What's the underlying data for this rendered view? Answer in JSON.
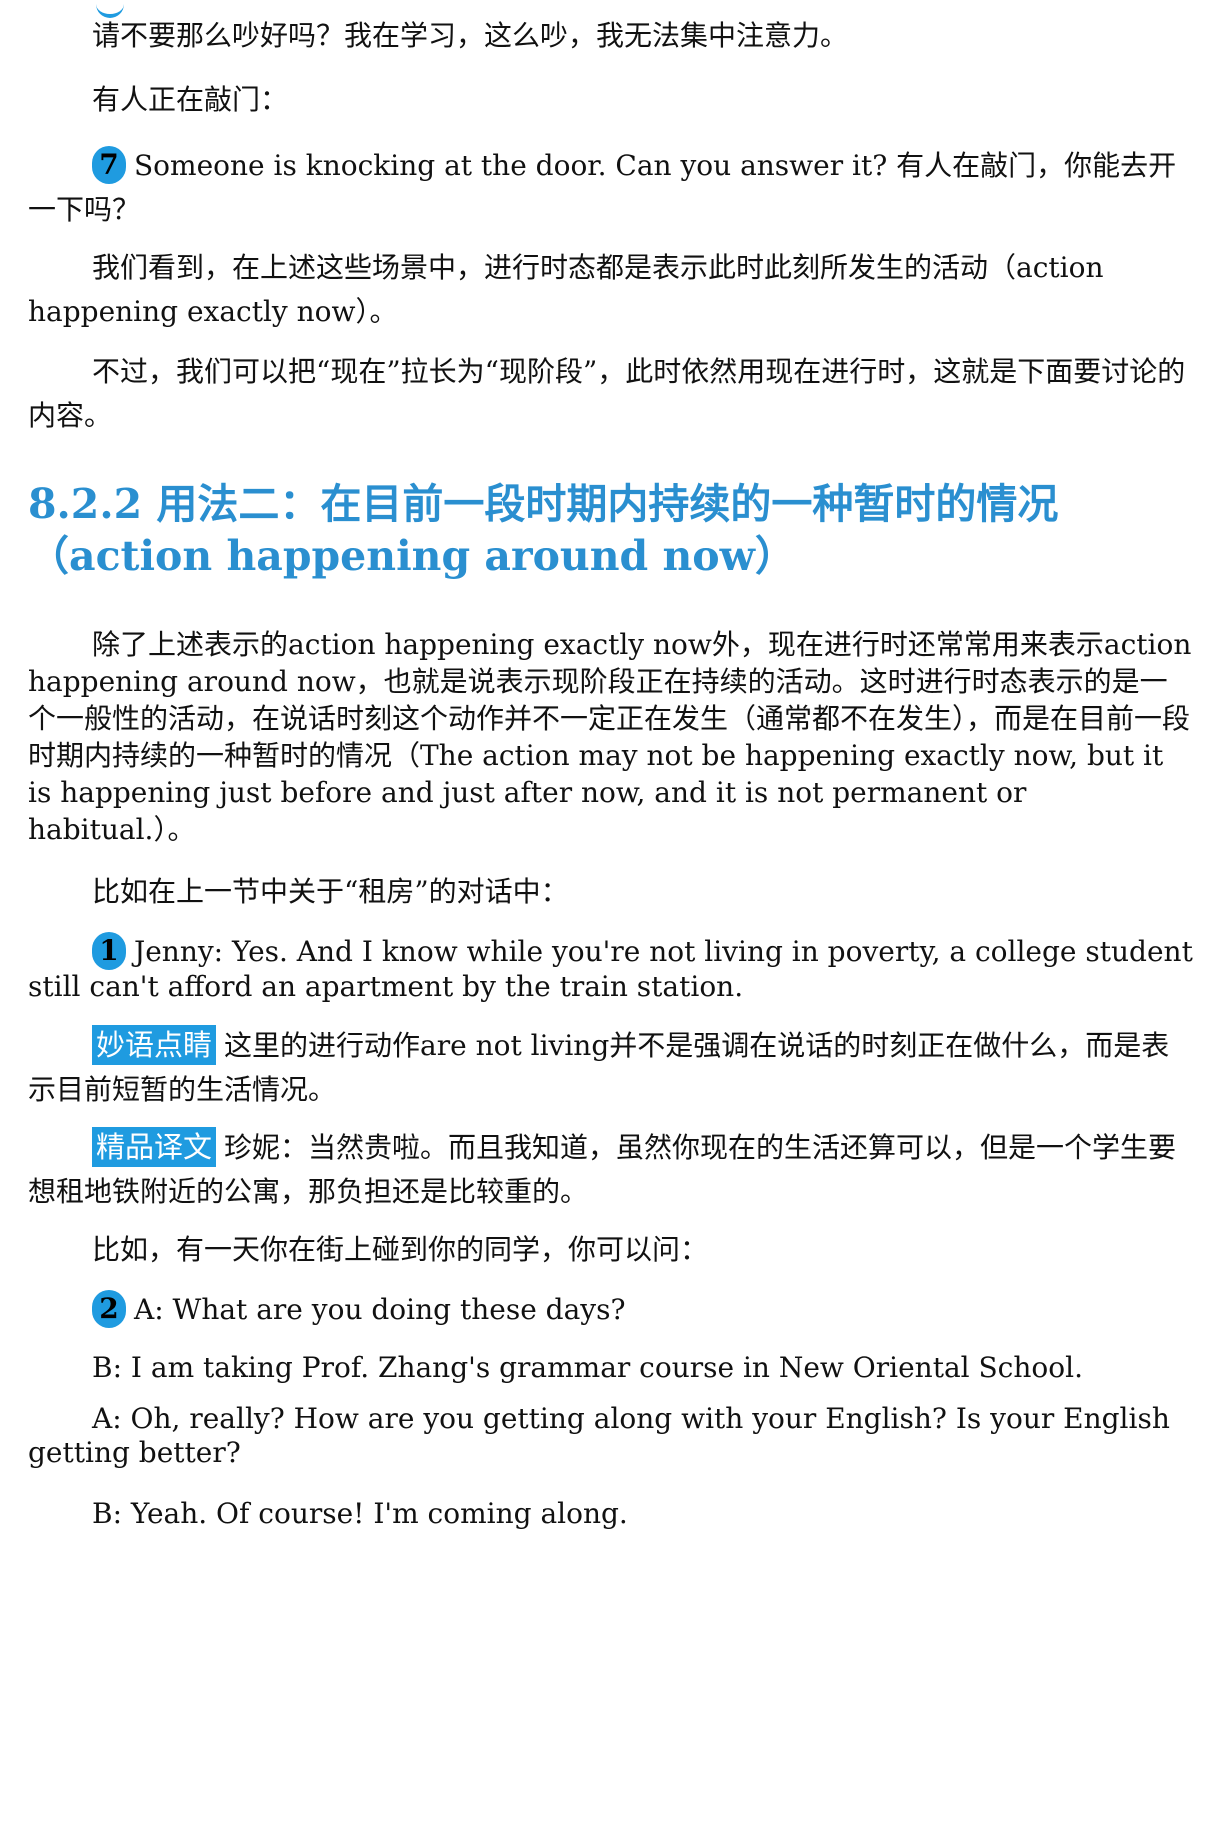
{
  "paragraphs": {
    "p_request_quiet": "请不要那么吵好吗？我在学习，这么吵，我无法集中注意力。",
    "p_knocking_intro": "有人正在敲门：",
    "p_example7_num": "7",
    "p_example7_text": "Someone is knocking at the door. Can you answer it? 有人在敲门，你能去开一下吗？",
    "p_summary": "我们看到，在上述这些场景中，进行时态都是表示此时此刻所发生的活动（action happening exactly now）。",
    "p_extend": "不过，我们可以把“现在”拉长为“现阶段”，此时依然用现在进行时，这就是下面要讨论的内容。"
  },
  "section": {
    "heading": "8.2.2 用法二：在目前一段时期内持续的一种暂时的情况（action happening around now）"
  },
  "body": {
    "p_explain": "除了上述表示的action happening exactly now外，现在进行时还常常用来表示action happening around now，也就是说表示现阶段正在持续的活动。这时进行时态表示的是一个一般性的活动，在说话时刻这个动作并不一定正在发生（通常都不在发生），而是在目前一段时期内持续的一种暂时的情况（The action may not be happening exactly now, but it is happening just before and just after now, and it is not permanent or habitual.）。",
    "p_rent_intro": "比如在上一节中关于“租房”的对话中：",
    "ex1_num": "1",
    "ex1_text": "Jenny: Yes. And I know while you're not living in poverty, a college student still can't afford an apartment by the train station.",
    "note_tag": "妙语点睛",
    "note_text": "这里的进行动作are not living并不是强调在说话的时刻正在做什么，而是表示目前短暂的生活情况。",
    "trans_tag": "精品译文",
    "trans_text": "珍妮：当然贵啦。而且我知道，虽然你现在的生活还算可以，但是一个学生要想租地铁附近的公寓，那负担还是比较重的。",
    "p_street_intro": "比如，有一天你在街上碰到你的同学，你可以问：",
    "ex2_num": "2",
    "ex2_a1": "A: What are you doing these days?",
    "ex2_b1": "B: I am taking Prof. Zhang's grammar course in New Oriental School.",
    "ex2_a2": "A: Oh, really? How are you getting along with your English? Is your English getting better?",
    "ex2_b2": "B: Yeah. Of course! I'm coming along."
  },
  "colors": {
    "accent": "#1f9be0",
    "heading": "#2a8fd0",
    "text": "#111111"
  }
}
